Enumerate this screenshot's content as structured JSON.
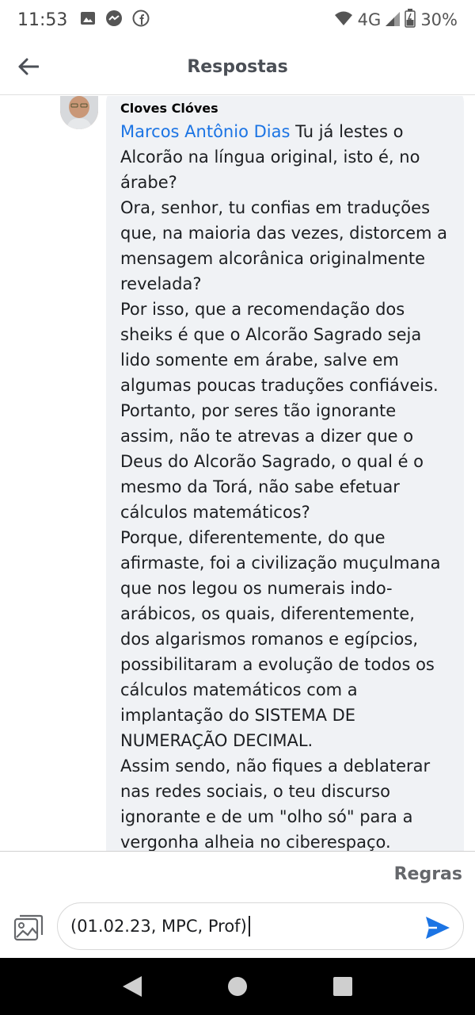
{
  "status_bar": {
    "time": "11:53",
    "network": "4G",
    "battery": "30%",
    "icons_left": [
      "image-icon",
      "messenger-icon",
      "facebook-icon"
    ]
  },
  "header": {
    "title": "Respostas"
  },
  "comment": {
    "author": "Cloves Clóves",
    "mention": "Marcos Antônio Dias",
    "first_line_rest": " Tu já lestes o Alcorão na língua original, isto é, no árabe?",
    "paragraphs": [
      "Ora, senhor, tu confias em traduções que, na maioria das vezes, distorcem a mensagem alcorânica originalmente revelada?",
      "Por isso, que a recomendação dos sheiks é que o Alcorão Sagrado seja lido somente em árabe, salve em algumas poucas traduções confiáveis.",
      "Portanto, por seres tão ignorante assim, não te atrevas a dizer que o Deus do Alcorão Sagrado, o qual é o mesmo da Torá, não sabe efetuar cálculos matemáticos?",
      "Porque, diferentemente, do que afirmaste, foi a civilização muçulmana que nos legou os numerais indo-arábicos, os quais, diferentemente, dos algarismos romanos e egípcios, possibilitaram a evolução de todos os cálculos matemáticos com a implantação do SISTEMA DE NUMERAÇÃO DECIMAL.",
      "Assim sendo, não fiques a deblaterar nas redes sociais, o teu discurso ignorante e de um \"olho só\" para a vergonha alheia no ciberespaço."
    ]
  },
  "footer": {
    "rules_label": "Regras",
    "input_value": "(01.02.23, MPC, Prof)"
  },
  "colors": {
    "mention": "#1b74e4",
    "send": "#1b74e4",
    "bubble": "#f0f2f5"
  }
}
